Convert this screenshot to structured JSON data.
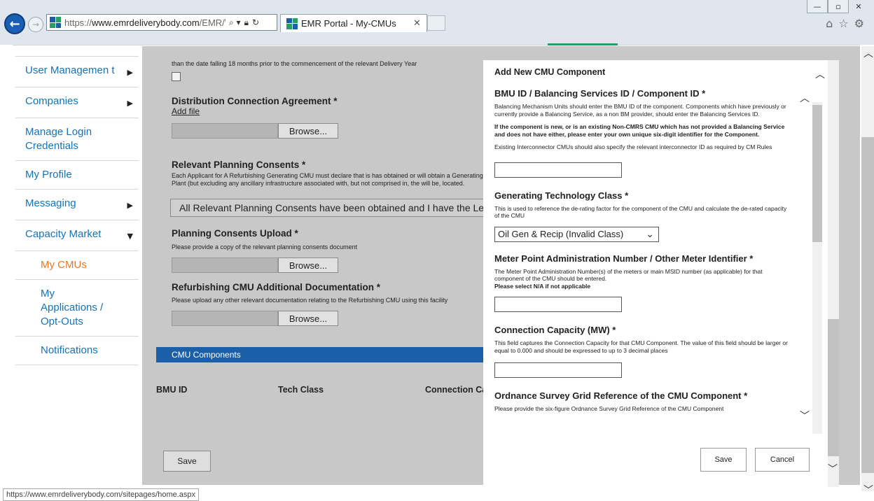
{
  "browser": {
    "url_prefix": "https://",
    "url_host": "www.emrdeliverybody.com",
    "url_rest": "/EMR/\\",
    "tab_title": "EMR Portal - My-CMUs",
    "status_url": "https://www.emrdeliverybody.com/sitepages/home.aspx"
  },
  "nav": {
    "items": [
      {
        "label": "User Managemen t",
        "arrow": "▶"
      },
      {
        "label": "Companies",
        "arrow": "▶"
      },
      {
        "label": "Manage Login Credentials",
        "arrow": ""
      },
      {
        "label": "My Profile",
        "arrow": ""
      },
      {
        "label": "Messaging",
        "arrow": "▶"
      },
      {
        "label": "Capacity Market",
        "arrow": "▼"
      },
      {
        "label": "My CMUs",
        "arrow": ""
      },
      {
        "label": "My Applications / Opt-Outs",
        "arrow": ""
      },
      {
        "label": "Notifications",
        "arrow": ""
      }
    ]
  },
  "page": {
    "top_text": "than the date falling 18 months prior to the commencement of the relevant Delivery Year",
    "dist_label": "Distribution Connection Agreement *",
    "add_file": "Add file",
    "browse": "Browse...",
    "planning_label": "Relevant Planning Consents *",
    "planning_text": "Each Applicant for A Refurbishing Generating CMU must declare that is has obtained or will obtain a Generating Plant (but excluding any ancillary infrastructure associated with, but not comprised in, the will be, located.",
    "planning_select": "All Relevant Planning Consents have been obtained and I have the Legal",
    "upload_label": "Planning Consents Upload *",
    "upload_text": "Please provide a copy of the relevant planning consents document",
    "refurb_label": "Refurbishing CMU Additional Documentation *",
    "refurb_text": "Please upload any other relevant documentation relating to the Refurbishing CMU using this facility",
    "cmu_components": "CMU Components",
    "columns": [
      "BMU ID",
      "Tech Class",
      "Connection Ca"
    ],
    "save": "Save"
  },
  "modal": {
    "title": "Add New CMU Component",
    "bmu_heading": "BMU ID / Balancing Services ID / Component ID *",
    "bmu_text": "Balancing Mechanism Units should enter the BMU ID of the component. Components which have previously or currently provide a Balancing Service, as a non BM provider, should enter the Balancing Services ID.",
    "bmu_bold": "If the component is new, or is an existing Non-CMRS CMU which has not provided a Balancing Service and does not have either, please enter your own unique six-digit identifier for the Component.",
    "bmu_text2": "Existing Interconnector CMUs should also specify the relevant interconnector ID as required by CM Rules",
    "gen_heading": "Generating Technology Class *",
    "gen_text": "This is used to reference the de-rating factor for the component of the CMU and calculate the de-rated capacity of the CMU",
    "gen_select": "Oil Gen & Recip (Invalid Class)",
    "meter_heading": "Meter Point Administration Number / Other Meter Identifier *",
    "meter_text": "The Meter Point Administration Number(s) of the meters or main MSID number (as applicable) for that component of the CMU should be entered.",
    "meter_bold": "Please select N/A if not applicable",
    "conn_heading": "Connection Capacity (MW) *",
    "conn_text": "This field captures the Connection Capacity for that CMU Component. The value of this field should be larger or equal to 0.000 and should be expressed to up to 3 decimal places",
    "grid_heading": "Ordnance Survey Grid Reference of the CMU Component *",
    "grid_text": "Please provide the six-figure Ordnance Survey Grid Reference of the CMU Component",
    "save": "Save",
    "cancel": "Cancel"
  },
  "colors": {
    "link": "#1473b8",
    "active": "#e87722",
    "overlay": "#c8c8c8",
    "bar": "#1a5fa8",
    "accent": "#2a9d62"
  }
}
